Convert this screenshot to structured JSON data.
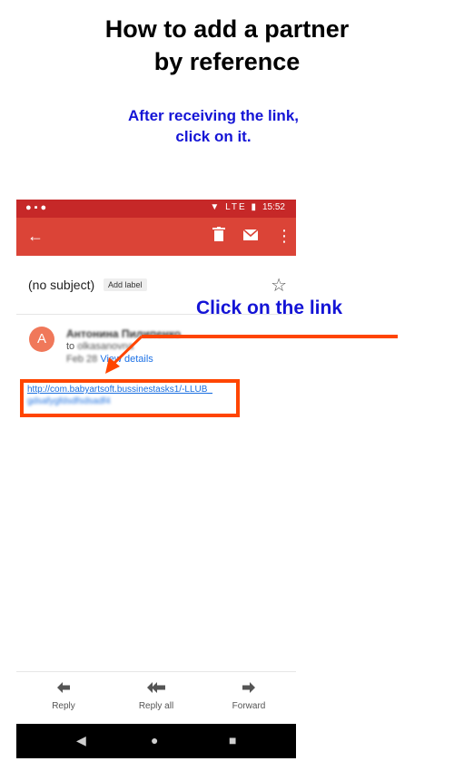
{
  "header": {
    "title_line1": "How to add a partner",
    "title_line2": "by reference",
    "instruction_line1": "After receiving the link,",
    "instruction_line2": "click on it."
  },
  "annotation": {
    "callout": "Click on the link",
    "accent_color": "#ff4500",
    "text_color": "#1414d6"
  },
  "phone": {
    "status_bar": {
      "icons": "LTE",
      "time": "15:52"
    },
    "app_bar": {
      "back_icon": "back-arrow-icon",
      "delete_icon": "trash-icon",
      "mail_icon": "mail-icon",
      "more_icon": "more-vert-icon"
    },
    "email": {
      "subject": "(no subject)",
      "label_chip": "Add label",
      "avatar_letter": "A",
      "sender": "Антонина Пилипенко",
      "to_prefix": "to",
      "recipient": "olkasanovna",
      "date": "Feb 28",
      "view_details": "View details",
      "link_line1": "http://com.babyartsoft.bussinestasks1/-LLUB_",
      "link_line2": "gdsafygfdsdfsdsadf4"
    },
    "actions": [
      {
        "label": "Reply",
        "icon": "reply-icon"
      },
      {
        "label": "Reply all",
        "icon": "reply-all-icon"
      },
      {
        "label": "Forward",
        "icon": "forward-icon"
      }
    ]
  }
}
